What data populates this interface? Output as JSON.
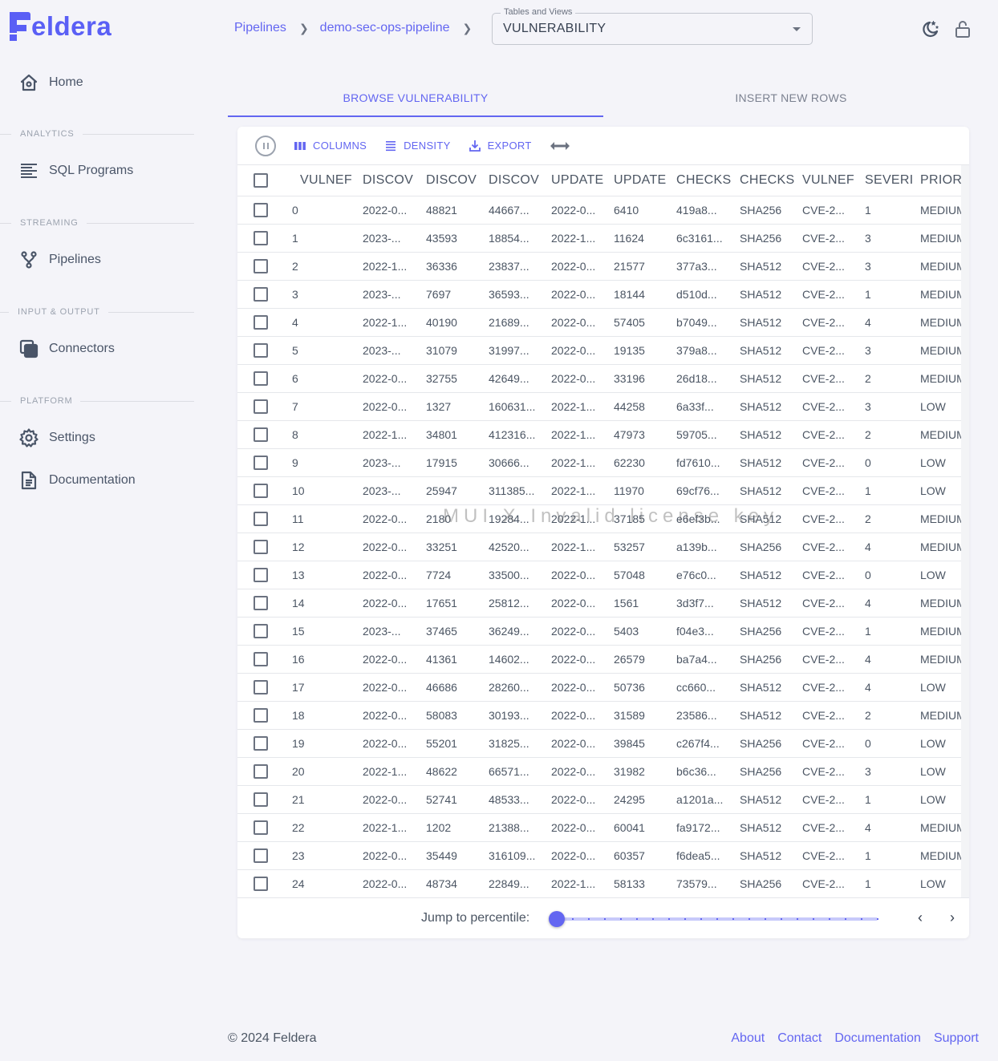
{
  "brand": {
    "name": "eldera",
    "color": "#5a5ff5"
  },
  "sidebar": {
    "home": {
      "label": "Home",
      "icon": "home-icon"
    },
    "sections": [
      {
        "title": "ANALYTICS",
        "items": [
          {
            "label": "SQL Programs",
            "icon": "text-lines-icon"
          }
        ]
      },
      {
        "title": "STREAMING",
        "items": [
          {
            "label": "Pipelines",
            "icon": "fork-icon"
          }
        ]
      },
      {
        "title": "INPUT & OUTPUT",
        "items": [
          {
            "label": "Connectors",
            "icon": "layers-icon"
          }
        ]
      },
      {
        "title": "PLATFORM",
        "items": [
          {
            "label": "Settings",
            "icon": "gear-icon"
          },
          {
            "label": "Documentation",
            "icon": "document-icon"
          }
        ]
      }
    ]
  },
  "breadcrumb": [
    "Pipelines",
    "demo-sec-ops-pipeline"
  ],
  "table_select": {
    "label": "Tables and Views",
    "value": "VULNERABILITY"
  },
  "header_icons": [
    "theme-toggle-icon",
    "lock-open-icon"
  ],
  "tabs": [
    {
      "label": "BROWSE VULNERABILITY",
      "active": true
    },
    {
      "label": "INSERT NEW ROWS",
      "active": false
    }
  ],
  "toolbar": {
    "columns": "COLUMNS",
    "density": "DENSITY",
    "export": "EXPORT"
  },
  "columns": [
    "VULNEF",
    "DISCOV",
    "DISCOV",
    "DISCOV",
    "UPDATE",
    "UPDATE",
    "CHECKS",
    "CHECKS",
    "VULNEF",
    "SEVERIT",
    "PRIOR"
  ],
  "rows": [
    [
      "0",
      "2022-0...",
      "48821",
      "44667...",
      "2022-0...",
      "6410",
      "419a8...",
      "SHA256",
      "CVE-2...",
      "1",
      "MEDIUM"
    ],
    [
      "1",
      "2023-...",
      "43593",
      "18854...",
      "2022-1...",
      "11624",
      "6c3161...",
      "SHA256",
      "CVE-2...",
      "3",
      "MEDIUM"
    ],
    [
      "2",
      "2022-1...",
      "36336",
      "23837...",
      "2022-0...",
      "21577",
      "377a3...",
      "SHA512",
      "CVE-2...",
      "3",
      "MEDIUM"
    ],
    [
      "3",
      "2023-...",
      "7697",
      "36593...",
      "2022-0...",
      "18144",
      "d510d...",
      "SHA512",
      "CVE-2...",
      "1",
      "MEDIUM"
    ],
    [
      "4",
      "2022-1...",
      "40190",
      "21689...",
      "2022-0...",
      "57405",
      "b7049...",
      "SHA512",
      "CVE-2...",
      "4",
      "MEDIUM"
    ],
    [
      "5",
      "2023-...",
      "31079",
      "31997...",
      "2022-0...",
      "19135",
      "379a8...",
      "SHA512",
      "CVE-2...",
      "3",
      "MEDIUM"
    ],
    [
      "6",
      "2022-0...",
      "32755",
      "42649...",
      "2022-0...",
      "33196",
      "26d18...",
      "SHA512",
      "CVE-2...",
      "2",
      "MEDIUM"
    ],
    [
      "7",
      "2022-0...",
      "1327",
      "160631...",
      "2022-1...",
      "44258",
      "6a33f...",
      "SHA512",
      "CVE-2...",
      "3",
      "LOW"
    ],
    [
      "8",
      "2022-1...",
      "34801",
      "412316...",
      "2022-1...",
      "47973",
      "59705...",
      "SHA512",
      "CVE-2...",
      "2",
      "MEDIUM"
    ],
    [
      "9",
      "2023-...",
      "17915",
      "30666...",
      "2022-1...",
      "62230",
      "fd7610...",
      "SHA512",
      "CVE-2...",
      "0",
      "LOW"
    ],
    [
      "10",
      "2023-...",
      "25947",
      "311385...",
      "2022-1...",
      "11970",
      "69cf76...",
      "SHA512",
      "CVE-2...",
      "1",
      "LOW"
    ],
    [
      "11",
      "2022-0...",
      "2180",
      "19284...",
      "2022-1...",
      "37185",
      "e6ef3b...",
      "SHA512",
      "CVE-2...",
      "2",
      "MEDIUM"
    ],
    [
      "12",
      "2022-0...",
      "33251",
      "42520...",
      "2022-1...",
      "53257",
      "a139b...",
      "SHA256",
      "CVE-2...",
      "4",
      "MEDIUM"
    ],
    [
      "13",
      "2022-0...",
      "7724",
      "33500...",
      "2022-0...",
      "57048",
      "e76c0...",
      "SHA512",
      "CVE-2...",
      "0",
      "LOW"
    ],
    [
      "14",
      "2022-0...",
      "17651",
      "25812...",
      "2022-0...",
      "1561",
      "3d3f7...",
      "SHA512",
      "CVE-2...",
      "4",
      "MEDIUM"
    ],
    [
      "15",
      "2023-...",
      "37465",
      "36249...",
      "2022-0...",
      "5403",
      "f04e3...",
      "SHA256",
      "CVE-2...",
      "1",
      "MEDIUM"
    ],
    [
      "16",
      "2022-0...",
      "41361",
      "14602...",
      "2022-0...",
      "26579",
      "ba7a4...",
      "SHA256",
      "CVE-2...",
      "4",
      "MEDIUM"
    ],
    [
      "17",
      "2022-0...",
      "46686",
      "28260...",
      "2022-0...",
      "50736",
      "cc660...",
      "SHA512",
      "CVE-2...",
      "4",
      "LOW"
    ],
    [
      "18",
      "2022-0...",
      "58083",
      "30193...",
      "2022-0...",
      "31589",
      "23586...",
      "SHA512",
      "CVE-2...",
      "2",
      "MEDIUM"
    ],
    [
      "19",
      "2022-0...",
      "55201",
      "31825...",
      "2022-0...",
      "39845",
      "c267f4...",
      "SHA256",
      "CVE-2...",
      "0",
      "LOW"
    ],
    [
      "20",
      "2022-1...",
      "48622",
      "66571...",
      "2022-0...",
      "31982",
      "b6c36...",
      "SHA256",
      "CVE-2...",
      "3",
      "LOW"
    ],
    [
      "21",
      "2022-0...",
      "52741",
      "48533...",
      "2022-0...",
      "24295",
      "a1201a...",
      "SHA512",
      "CVE-2...",
      "1",
      "LOW"
    ],
    [
      "22",
      "2022-1...",
      "1202",
      "21388...",
      "2022-0...",
      "60041",
      "fa9172...",
      "SHA512",
      "CVE-2...",
      "4",
      "MEDIUM"
    ],
    [
      "23",
      "2022-0...",
      "35449",
      "316109...",
      "2022-0...",
      "60357",
      "f6dea5...",
      "SHA512",
      "CVE-2...",
      "1",
      "MEDIUM"
    ],
    [
      "24",
      "2022-0...",
      "48734",
      "22849...",
      "2022-1...",
      "58133",
      "73579...",
      "SHA256",
      "CVE-2...",
      "1",
      "LOW"
    ]
  ],
  "pagination": {
    "jump_label": "Jump to percentile:",
    "percentile": 0
  },
  "watermark": "MUI X Invalid license key",
  "footer": {
    "copyright": "© 2024 Feldera",
    "links": [
      "About",
      "Contact",
      "Documentation",
      "Support"
    ]
  },
  "colors": {
    "accent": "#6366f1",
    "background": "#f4f4f9",
    "text": "#4b5563"
  }
}
